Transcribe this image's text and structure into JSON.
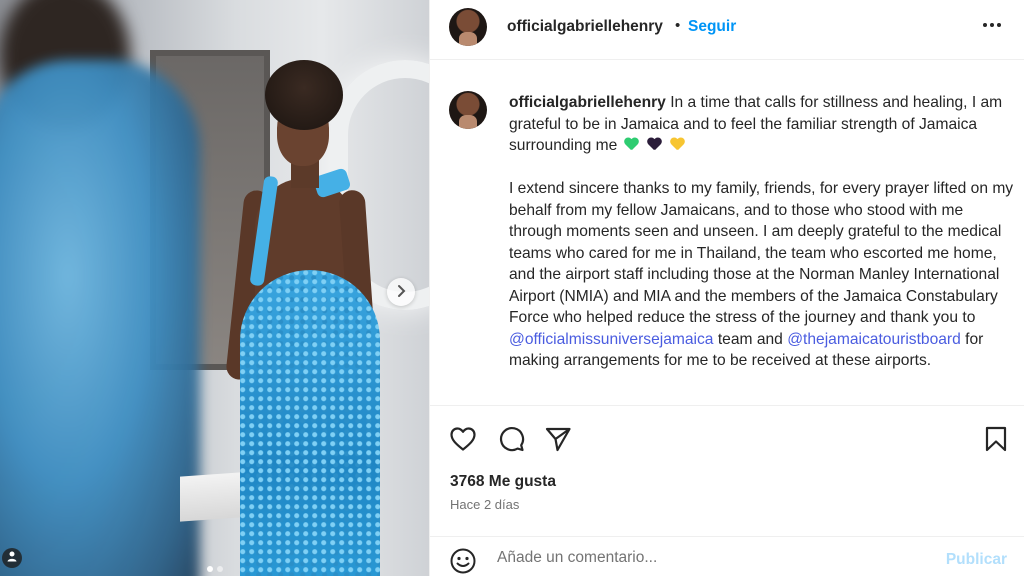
{
  "post": {
    "username": "officialgabriellehenry",
    "follow_label": "Seguir",
    "bullet": "•",
    "caption": {
      "username": "officialgabriellehenry",
      "paragraph1": "In a time that calls for stillness and healing, I am grateful to be in Jamaica and to feel the familiar strength of Jamaica surrounding me",
      "hearts": [
        {
          "icon": "green-heart-emoji",
          "color": "#2ecc71"
        },
        {
          "icon": "black-heart-emoji",
          "color": "#2b1d3a"
        },
        {
          "icon": "yellow-heart-emoji",
          "color": "#f7c531"
        }
      ],
      "paragraph2_part1": "I extend sincere thanks to my family, friends, for every prayer lifted on my behalf from my fellow Jamaicans, and to those who stood with me through moments seen and unseen. I am deeply grateful to the medical teams who cared for me in Thailand, the team who escorted me home, and the airport staff including those at the Norman Manley International Airport (NMIA) and MIA and the members of the Jamaica Constabulary Force who helped reduce the stress of the journey and thank you to",
      "mention1": "@officialmissuniversejamaica",
      "paragraph2_part2": "team and",
      "mention2": "@thejamaicatouristboard",
      "paragraph2_part3": "for making arrangements for me to be received at these airports."
    },
    "likes": "3768 Me gusta",
    "time": "Hace 2 días",
    "comment_placeholder": "Añade un comentario...",
    "publish_label": "Publicar",
    "carousel": {
      "total": 2,
      "active": 0
    },
    "colors": {
      "accent": "#0095f6",
      "mention": "#4a5ce0",
      "publish_disabled": "#b2dffc",
      "dress": "#2a9ad6"
    },
    "icons": {
      "like": "heart-icon",
      "comment": "comment-icon",
      "share": "send-icon",
      "save": "bookmark-icon",
      "emoji": "smiley-icon",
      "more": "more-options-icon",
      "next": "chevron-right-icon",
      "tag": "user-tag-icon"
    }
  }
}
